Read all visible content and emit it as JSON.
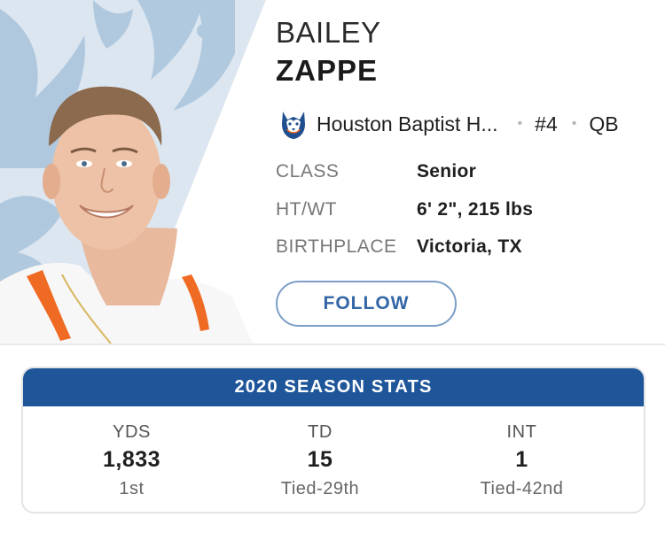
{
  "player": {
    "first_name": "BAILEY",
    "last_name": "ZAPPE",
    "team": "Houston Baptist H...",
    "number": "#4",
    "position": "QB"
  },
  "info": [
    {
      "label": "CLASS",
      "value": "Senior"
    },
    {
      "label": "HT/WT",
      "value": "6' 2\", 215 lbs"
    },
    {
      "label": "BIRTHPLACE",
      "value": "Victoria, TX"
    }
  ],
  "follow_label": "FOLLOW",
  "stats": {
    "title": "2020 SEASON STATS",
    "columns": [
      {
        "label": "YDS",
        "value": "1,833",
        "rank": "1st"
      },
      {
        "label": "TD",
        "value": "15",
        "rank": "Tied-29th"
      },
      {
        "label": "INT",
        "value": "1",
        "rank": "Tied-42nd"
      }
    ]
  },
  "colors": {
    "accent_blue": "#1f569a",
    "follow_text": "#3366a6",
    "follow_border": "#7c9ec6",
    "team_orange": "#ef6a23"
  },
  "icons": {
    "team_logo": "husky-logo-icon"
  }
}
